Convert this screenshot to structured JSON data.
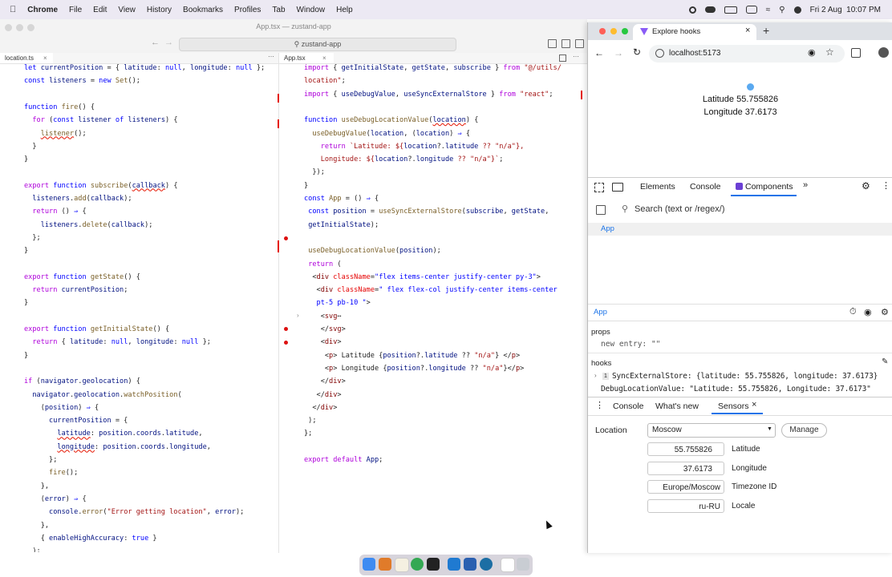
{
  "menubar": {
    "app": "Chrome",
    "items": [
      "File",
      "Edit",
      "View",
      "History",
      "Bookmarks",
      "Profiles",
      "Tab",
      "Window",
      "Help"
    ],
    "clock": "Fri 2 Aug  10:07 PM"
  },
  "vscode": {
    "window_title": "App.tsx — zustand-app",
    "search": "zustand-app",
    "left_tab": "location.ts",
    "right_tab": "App.tsx"
  },
  "left_code": [
    "let currentPosition = { latitude: null, longitude: null };",
    "const listeners = new Set();",
    "",
    "function fire() {",
    "  for (const listener of listeners) {",
    "    listener();",
    "  }",
    "}",
    "",
    "export function subscribe(callback) {",
    "  listeners.add(callback);",
    "  return () => {",
    "    listeners.delete(callback);",
    "  };",
    "}",
    "",
    "export function getState() {",
    "  return currentPosition;",
    "}",
    "",
    "export function getInitialState() {",
    "  return { latitude: null, longitude: null };",
    "}",
    "",
    "if (navigator.geolocation) {",
    "  navigator.geolocation.watchPosition(",
    "    (position) => {",
    "      currentPosition = {",
    "        latitude: position.coords.latitude,",
    "        longitude: position.coords.longitude,",
    "      };",
    "      fire();",
    "    },",
    "    (error) => {",
    "      console.error(\"Error getting location\", error);",
    "    },",
    "    { enableHighAccuracy: true }",
    "  );"
  ],
  "right_code": [
    "import { getInitialState, getState, subscribe } from \"@/utils/",
    "location\";",
    "import { useDebugValue, useSyncExternalStore } from \"react\";",
    "",
    "function useDebugLocationValue(location) {",
    "  useDebugValue(location, (location) => {",
    "    return `Latitude: ${location?.latitude ?? \"n/a\"},",
    "    Longitude: ${location?.longitude ?? \"n/a\"}`;",
    "  });",
    "}",
    "const App = () => {",
    " const position = useSyncExternalStore(subscribe, getState,",
    " getInitialState);",
    "",
    " useDebugLocationValue(position);",
    " return (",
    "  <div className=\"flex items-center justify-center py-3\">",
    "   <div className=\" flex flex-col justify-center items-center",
    "   pt-5 pb-10 \">",
    "    <svg⋯",
    "    </svg>",
    "    <div>",
    "     <p> Latitude {position?.latitude ?? \"n/a\"} </p>",
    "     <p> Longitude {position?.longitude ?? \"n/a\"}</p>",
    "    </div>",
    "   </div>",
    "  </div>",
    " );",
    "};",
    "",
    "export default App;"
  ],
  "browser": {
    "tab_title": "Explore hooks",
    "url": "localhost:5173",
    "page": {
      "latitude_text": "Latitude 55.755826",
      "longitude_text": "Longitude 37.6173"
    }
  },
  "devtools": {
    "tabs": [
      "Elements",
      "Console",
      "Components"
    ],
    "search_placeholder": "Search (text or /regex/)",
    "tree_item": "App",
    "selected": "App",
    "props_header": "props",
    "props_entry": "new entry: \"\"",
    "hooks_header": "hooks",
    "hook1_index": "1",
    "hook1": "SyncExternalStore: {latitude: 55.755826, longitude: 37.6173}",
    "hook2": "DebugLocationValue: \"Latitude: 55.755826, Longitude: 37.6173\"",
    "drawer_tabs": [
      "Console",
      "What's new",
      "Sensors"
    ],
    "sensors": {
      "location_label": "Location",
      "location_value": "Moscow",
      "manage": "Manage",
      "latitude": "55.755826",
      "latitude_label": "Latitude",
      "longitude": "37.6173",
      "longitude_label": "Longitude",
      "timezone": "Europe/Moscow",
      "timezone_label": "Timezone ID",
      "locale": "ru-RU",
      "locale_label": "Locale"
    }
  },
  "colors": {
    "accent": "#1a73e8",
    "components_tab": "#6b3fd4"
  }
}
